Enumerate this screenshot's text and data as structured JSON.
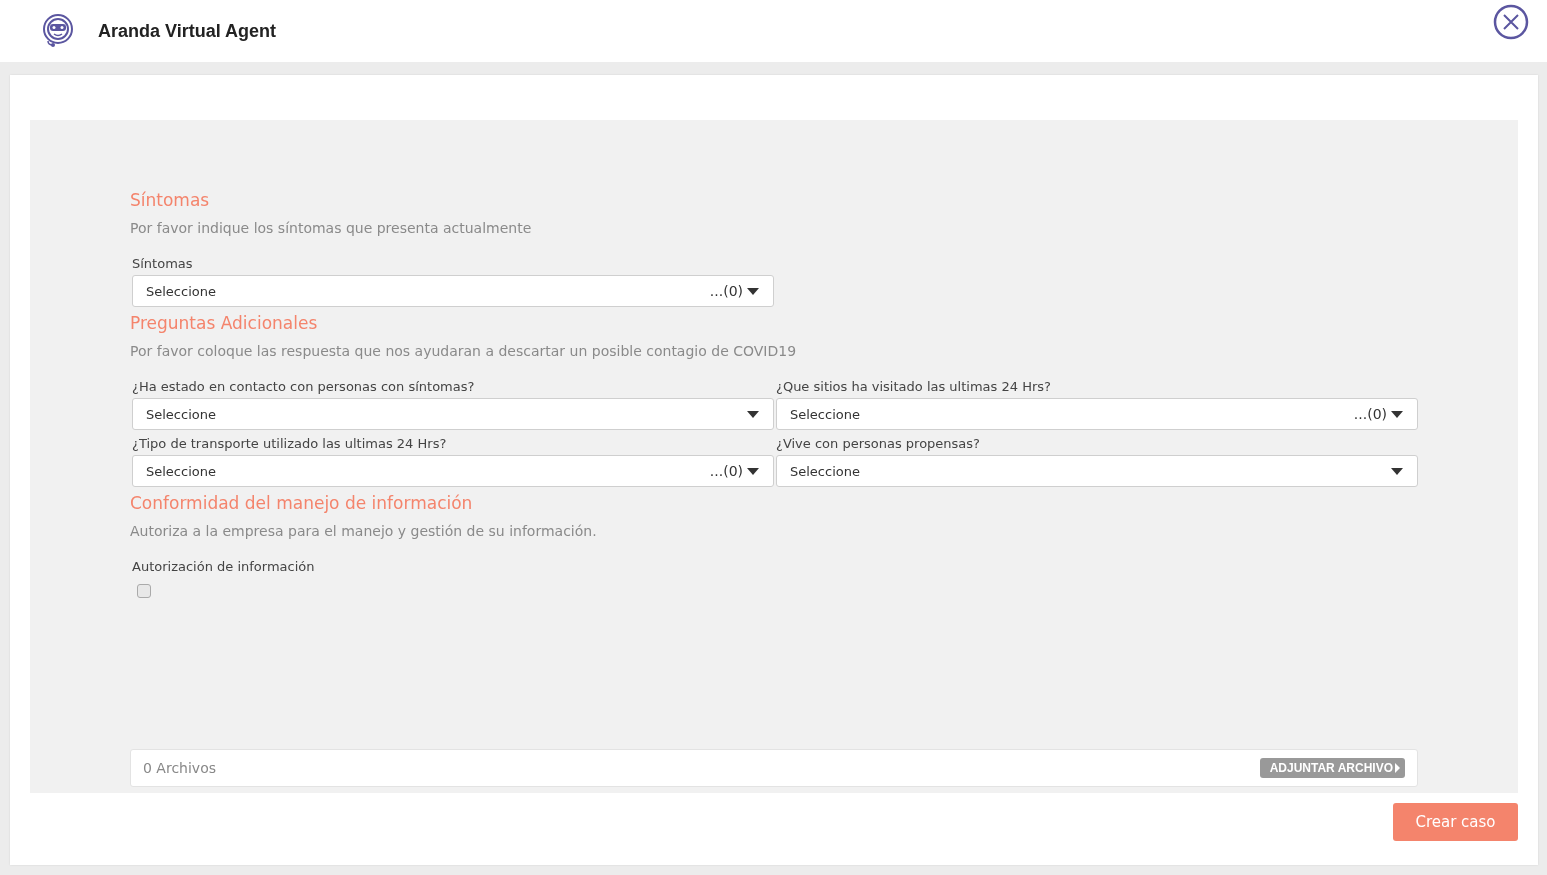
{
  "header": {
    "title": "Aranda Virtual Agent"
  },
  "sections": [
    {
      "title": "Síntomas",
      "description": "Por favor indique los síntomas que presenta actualmente",
      "fields": [
        {
          "kind": "multi",
          "label": "Síntomas",
          "value": "Seleccione",
          "count": "...(0)"
        }
      ]
    },
    {
      "title": "Preguntas Adicionales",
      "description": "Por favor coloque las respuesta que nos ayudaran a descartar un posible contagio de COVID19",
      "fields": [
        {
          "kind": "single",
          "label": "¿Ha estado en contacto con personas con síntomas?",
          "value": "Seleccione"
        },
        {
          "kind": "multi",
          "label": "¿Que sitios ha visitado las ultimas 24 Hrs?",
          "value": "Seleccione",
          "count": "...(0)"
        },
        {
          "kind": "multi",
          "label": "¿Tipo de transporte utilizado las ultimas 24 Hrs?",
          "value": "Seleccione",
          "count": "...(0)"
        },
        {
          "kind": "single",
          "label": "¿Vive con personas propensas?",
          "value": "Seleccione"
        }
      ]
    },
    {
      "title": "Conformidad del manejo de información",
      "description": "Autoriza a la empresa para el manejo y gestión de su información.",
      "fields": [
        {
          "kind": "checkbox",
          "label": "Autorización de información",
          "checked": false
        }
      ]
    }
  ],
  "attachments": {
    "count_text": "0 Archivos",
    "button": "ADJUNTAR ARCHIVO"
  },
  "submit": "Crear caso"
}
